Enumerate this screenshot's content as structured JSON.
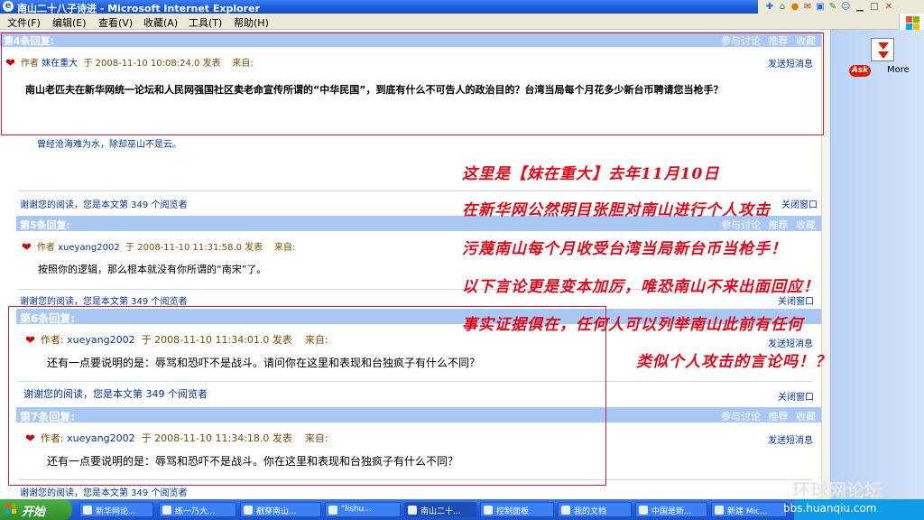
{
  "window": {
    "title": "南山二十八子诗进 - Microsoft Internet Explorer"
  },
  "menu": {
    "items": [
      "文件(F)",
      "编辑(E)",
      "查看(V)",
      "收藏(A)",
      "工具(T)",
      "帮助(H)"
    ]
  },
  "sidepanel": {
    "ask_label": "Ask",
    "more_label": "More"
  },
  "actions": {
    "discuss": "参与讨论",
    "recommend": "推荐",
    "collect": "收藏",
    "send_sms": "发送短消息",
    "close_window": "关闭窗口"
  },
  "thanks_line": "谢谢您的阅读，您是本文第 349 个阅览者",
  "posts": [
    {
      "label": "第4条回复:",
      "author": "妹在重大",
      "time": "2008-11-10 10:08:24.0 发表",
      "from": "来自:",
      "body": "南山老匹夫在新华网统一论坛和人民网强国社区卖老命宣传所谓的“中华民国”，到底有什么不可告人的政治目的？台湾当局每个月花多少新台币聘请您当枪手？",
      "signature": "曾经沧海难为水，除却巫山不是云。"
    },
    {
      "label": "第5条回复:",
      "author": "xueyang2002",
      "time": "2008-11-10 11:31:58.0 发表",
      "from": "来自:",
      "body": "按照你的逻辑，那么根本就没有你所谓的“南宋”了。"
    },
    {
      "label": "第6条回复:",
      "author": "xueyang2002",
      "time": "2008-11-10 11:34:01.0 发表",
      "from": "来自:",
      "body": "还有一点要说明的是：辱骂和恐吓不是战斗。请问你在这里和表现和台独疯子有什么不同？"
    },
    {
      "label": "第7条回复:",
      "author": "xueyang2002",
      "time": "2008-11-10 11:34:18.0 发表",
      "from": "来自:",
      "body": "还有一点要说明的是：辱骂和恐吓不是战斗。你在这里和表现和台独疯子有什么不同？"
    }
  ],
  "author_prefix": "作者",
  "author_prefix_colon": "作者:",
  "time_prefix": "于",
  "annotation": {
    "lines": [
      "这里是【妹在重大】去年11月10日",
      "在新华网公然明目张胆对南山进行个人攻击",
      "污蔑南山每个月收受台湾当局新台币当枪手！",
      "以下言论更是变本加厉，唯恐南山不来出面回应！",
      "事实证据俱在，任何人可以列举南山此前有任何",
      "类似个人攻击的言论吗！？"
    ]
  },
  "taskbar": {
    "start": "开始",
    "items": [
      "新华网论...",
      "练一乃大...",
      "戳穿南山...",
      "\"lishu...",
      "南山二十...",
      "控制面板",
      "我的文档",
      "中国是新...",
      "新建 Mic..."
    ]
  },
  "watermark": {
    "brand": "环球网论坛",
    "url": "bbs.huanqiu.com"
  },
  "colors": {
    "accent": "#a9c8f3",
    "annotation": "#e00a1a",
    "highlight_box": "#d02040"
  }
}
